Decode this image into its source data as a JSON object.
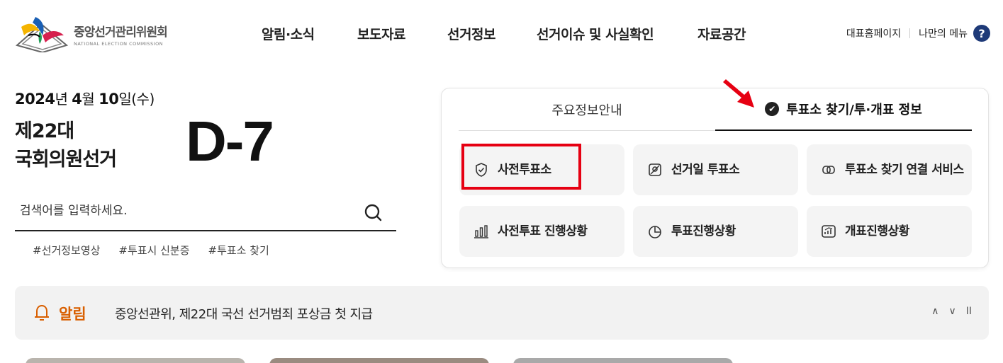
{
  "header": {
    "logo_ko": "중앙선거관리위원회",
    "logo_en": "NATIONAL ELECTION COMMISSION",
    "nav": [
      "알림·소식",
      "보도자료",
      "선거정보",
      "선거이슈 및 사실확인",
      "자료공간"
    ],
    "util_home": "대표홈페이지",
    "util_menu": "나만의 메뉴",
    "help_icon": "?"
  },
  "election": {
    "year": "2024",
    "year_unit": "년",
    "month": "4",
    "month_unit": "월",
    "day": "10",
    "day_unit": "일(수)",
    "name_line1": "제22대",
    "name_line2": "국회의원선거",
    "dday": "D-7"
  },
  "search": {
    "placeholder": "검색어를 입력하세요."
  },
  "hashtags": [
    "#선거정보영상",
    "#투표시 신분증",
    "#투표소 찾기"
  ],
  "card": {
    "tabs": {
      "inactive": "주요정보안내",
      "active": "투표소 찾기/투·개표 정보"
    },
    "buttons": [
      {
        "label": "사전투표소",
        "icon": "shield-check-icon"
      },
      {
        "label": "선거일 투표소",
        "icon": "map-pin-icon"
      },
      {
        "label": "투표소 찾기 연결 서비스",
        "icon": "link-icon"
      },
      {
        "label": "사전투표 진행상황",
        "icon": "bar-chart-icon"
      },
      {
        "label": "투표진행상황",
        "icon": "pie-chart-icon"
      },
      {
        "label": "개표진행상황",
        "icon": "trend-chart-icon"
      }
    ]
  },
  "notice": {
    "title": "알림",
    "text": "중앙선관위, 제22대 국선 선거범죄 포상금 첫 지급",
    "controls": [
      "∧",
      "∨",
      "II"
    ]
  },
  "colors": {
    "accent_orange": "#d95f00",
    "highlight_red": "#e60012",
    "help_navy": "#1e3a78"
  }
}
